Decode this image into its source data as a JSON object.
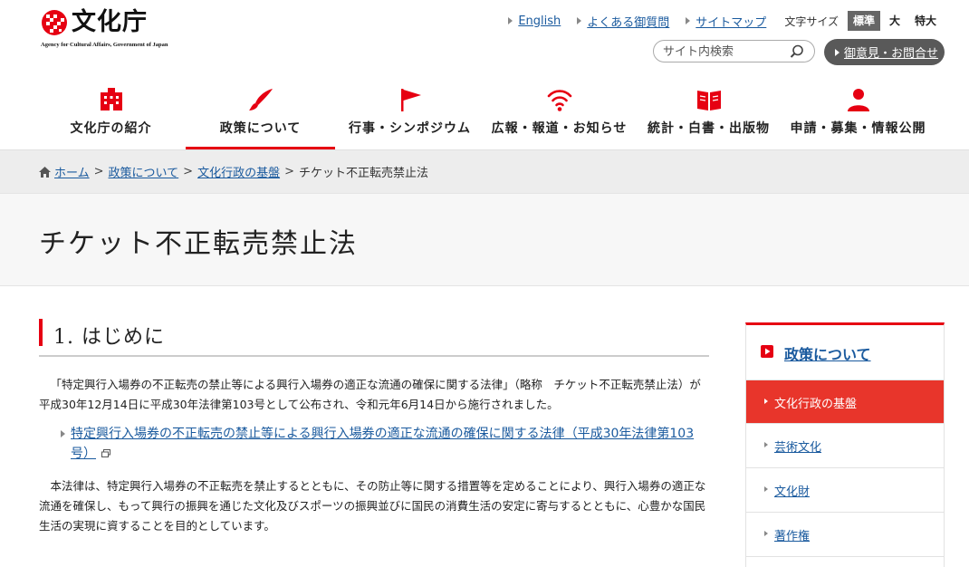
{
  "header": {
    "logo_text": "文化庁",
    "logo_sub": "Agency for Cultural Affairs, Government of Japan",
    "util_links": [
      "English",
      "よくある御質問",
      "サイトマップ"
    ],
    "font_size_label": "文字サイズ",
    "font_sizes": [
      "標準",
      "大",
      "特大"
    ],
    "font_size_selected": "標準",
    "search_placeholder": "サイト内検索",
    "contact_label": "御意見・お問合せ"
  },
  "gnav": [
    {
      "label": "文化庁の紹介",
      "icon": "building-icon"
    },
    {
      "label": "政策について",
      "icon": "brush-icon",
      "active": true
    },
    {
      "label": "行事・シンポジウム",
      "icon": "flag-icon"
    },
    {
      "label": "広報・報道・お知らせ",
      "icon": "broadcast-icon"
    },
    {
      "label": "統計・白書・出版物",
      "icon": "book-icon"
    },
    {
      "label": "申請・募集・情報公開",
      "icon": "person-icon"
    }
  ],
  "breadcrumb": {
    "items": [
      "ホーム",
      "政策について",
      "文化行政の基盤"
    ],
    "current": "チケット不正転売禁止法"
  },
  "page_title": "チケット不正転売禁止法",
  "section": {
    "heading": "1. はじめに",
    "para1": "「特定興行入場券の不正転売の禁止等による興行入場券の適正な流通の確保に関する法律」（略称　チケット不正転売禁止法）が平成30年12月14日に平成30年法律第103号として公布され、令和元年6月14日から施行されました。",
    "law_link": "特定興行入場券の不正転売の禁止等による興行入場券の適正な流通の確保に関する法律（平成30年法律第103号）",
    "para2": "本法律は、特定興行入場券の不正転売を禁止するとともに、その防止等に関する措置等を定めることにより、興行入場券の適正な流通を確保し、もって興行の振興を通じた文化及びスポーツの振興並びに国民の消費生活の安定に寄与するとともに、心豊かな国民生活の実現に資することを目的としています。"
  },
  "side": {
    "heading": "政策について",
    "items": [
      "文化行政の基盤",
      "芸術文化",
      "文化財",
      "著作権"
    ],
    "active": "文化行政の基盤"
  },
  "colors": {
    "accent": "#e60012",
    "link": "#1a5a9e",
    "side_active": "#e8352b"
  }
}
